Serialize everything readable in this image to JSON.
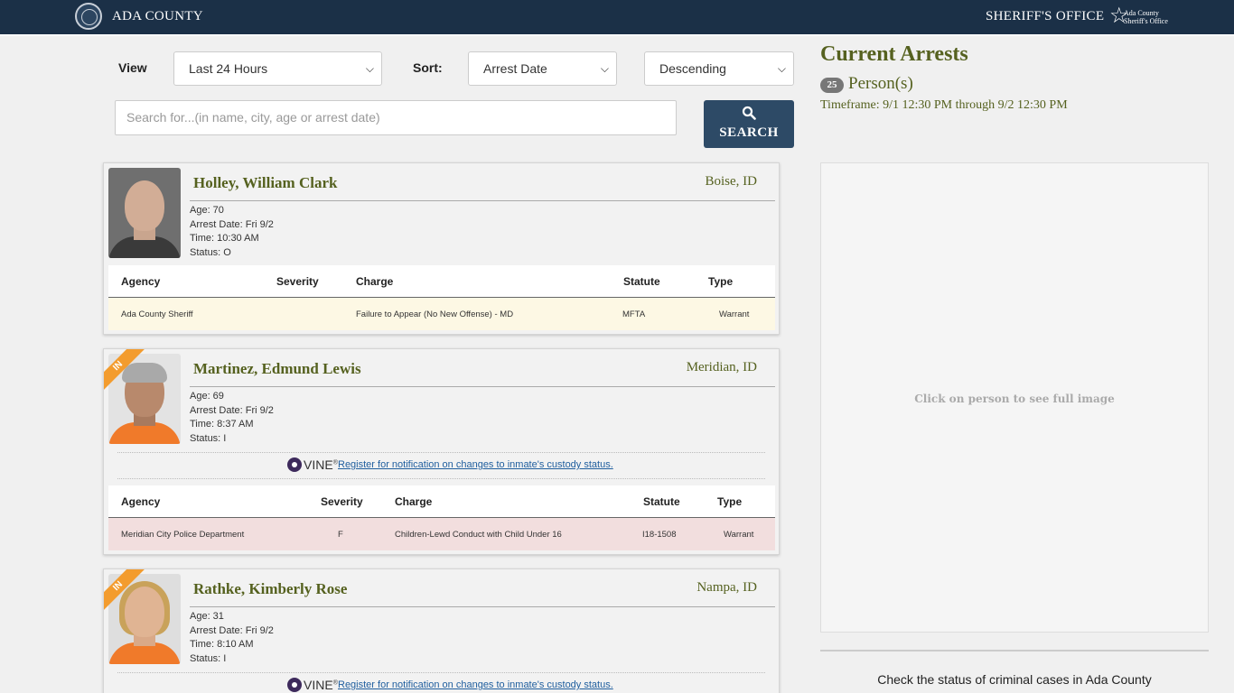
{
  "header": {
    "county_name": "ADA COUNTY",
    "office_name": "SHERIFF'S OFFICE",
    "logo_line1": "Ada County",
    "logo_line2": "Sheriff's Office"
  },
  "filters": {
    "view_label": "View",
    "view_value": "Last 24 Hours",
    "sort_label": "Sort:",
    "sort_value": "Arrest Date",
    "order_value": "Descending",
    "search_placeholder": "Search for...(in name, city, age or arrest date)",
    "search_button": "SEARCH"
  },
  "vine": {
    "logo_text": "VINE",
    "link_text": " Register for notification on changes to inmate's custody status."
  },
  "arrests": [
    {
      "name": "Holley, William Clark",
      "city": "Boise, ID",
      "age": "Age: 70",
      "arrest_date": "Arrest Date: Fri 9/2",
      "time": "Time: 10:30 AM",
      "status": "Status: O",
      "ribbon": "",
      "headers": [
        "Agency",
        "Severity",
        "Charge",
        "Statute",
        "Type"
      ],
      "charge": {
        "agency": "Ada County Sheriff",
        "severity": "",
        "charge": "Failure to Appear (No New Offense) - MD",
        "statute": "MFTA",
        "type": "Warrant"
      },
      "row_color": "#fdf8e4"
    },
    {
      "name": "Martinez, Edmund Lewis",
      "city": "Meridian, ID",
      "age": "Age: 69",
      "arrest_date": "Arrest Date: Fri 9/2",
      "time": "Time: 8:37 AM",
      "status": "Status: I",
      "ribbon": "IN",
      "headers": [
        "Agency",
        "Severity",
        "Charge",
        "Statute",
        "Type"
      ],
      "charge": {
        "agency": "Meridian City Police Department",
        "severity": "F",
        "charge": "Children-Lewd Conduct with Child Under 16",
        "statute": "I18-1508",
        "type": "Warrant"
      },
      "row_color": "#f2dede"
    },
    {
      "name": "Rathke, Kimberly Rose",
      "city": "Nampa, ID",
      "age": "Age: 31",
      "arrest_date": "Arrest Date: Fri 9/2",
      "time": "Time: 8:10 AM",
      "status": "Status: I",
      "ribbon": "IN"
    }
  ],
  "summary": {
    "title": "Current Arrests",
    "count": "25",
    "persons_label": "Person(s)",
    "timeframe": "Timeframe: 9/1 12:30 PM through 9/2 12:30 PM",
    "image_hint": "Click on person to see full image",
    "cases_link": "Check the status of criminal cases in Ada County"
  },
  "colors": {
    "header_bg": "#1b3047",
    "accent_olive": "#55611f",
    "search_button": "#2d4a66",
    "in_ribbon": "#f39c2e",
    "felony_row": "#f2dede",
    "misdemeanor_row": "#fdf8e4"
  }
}
